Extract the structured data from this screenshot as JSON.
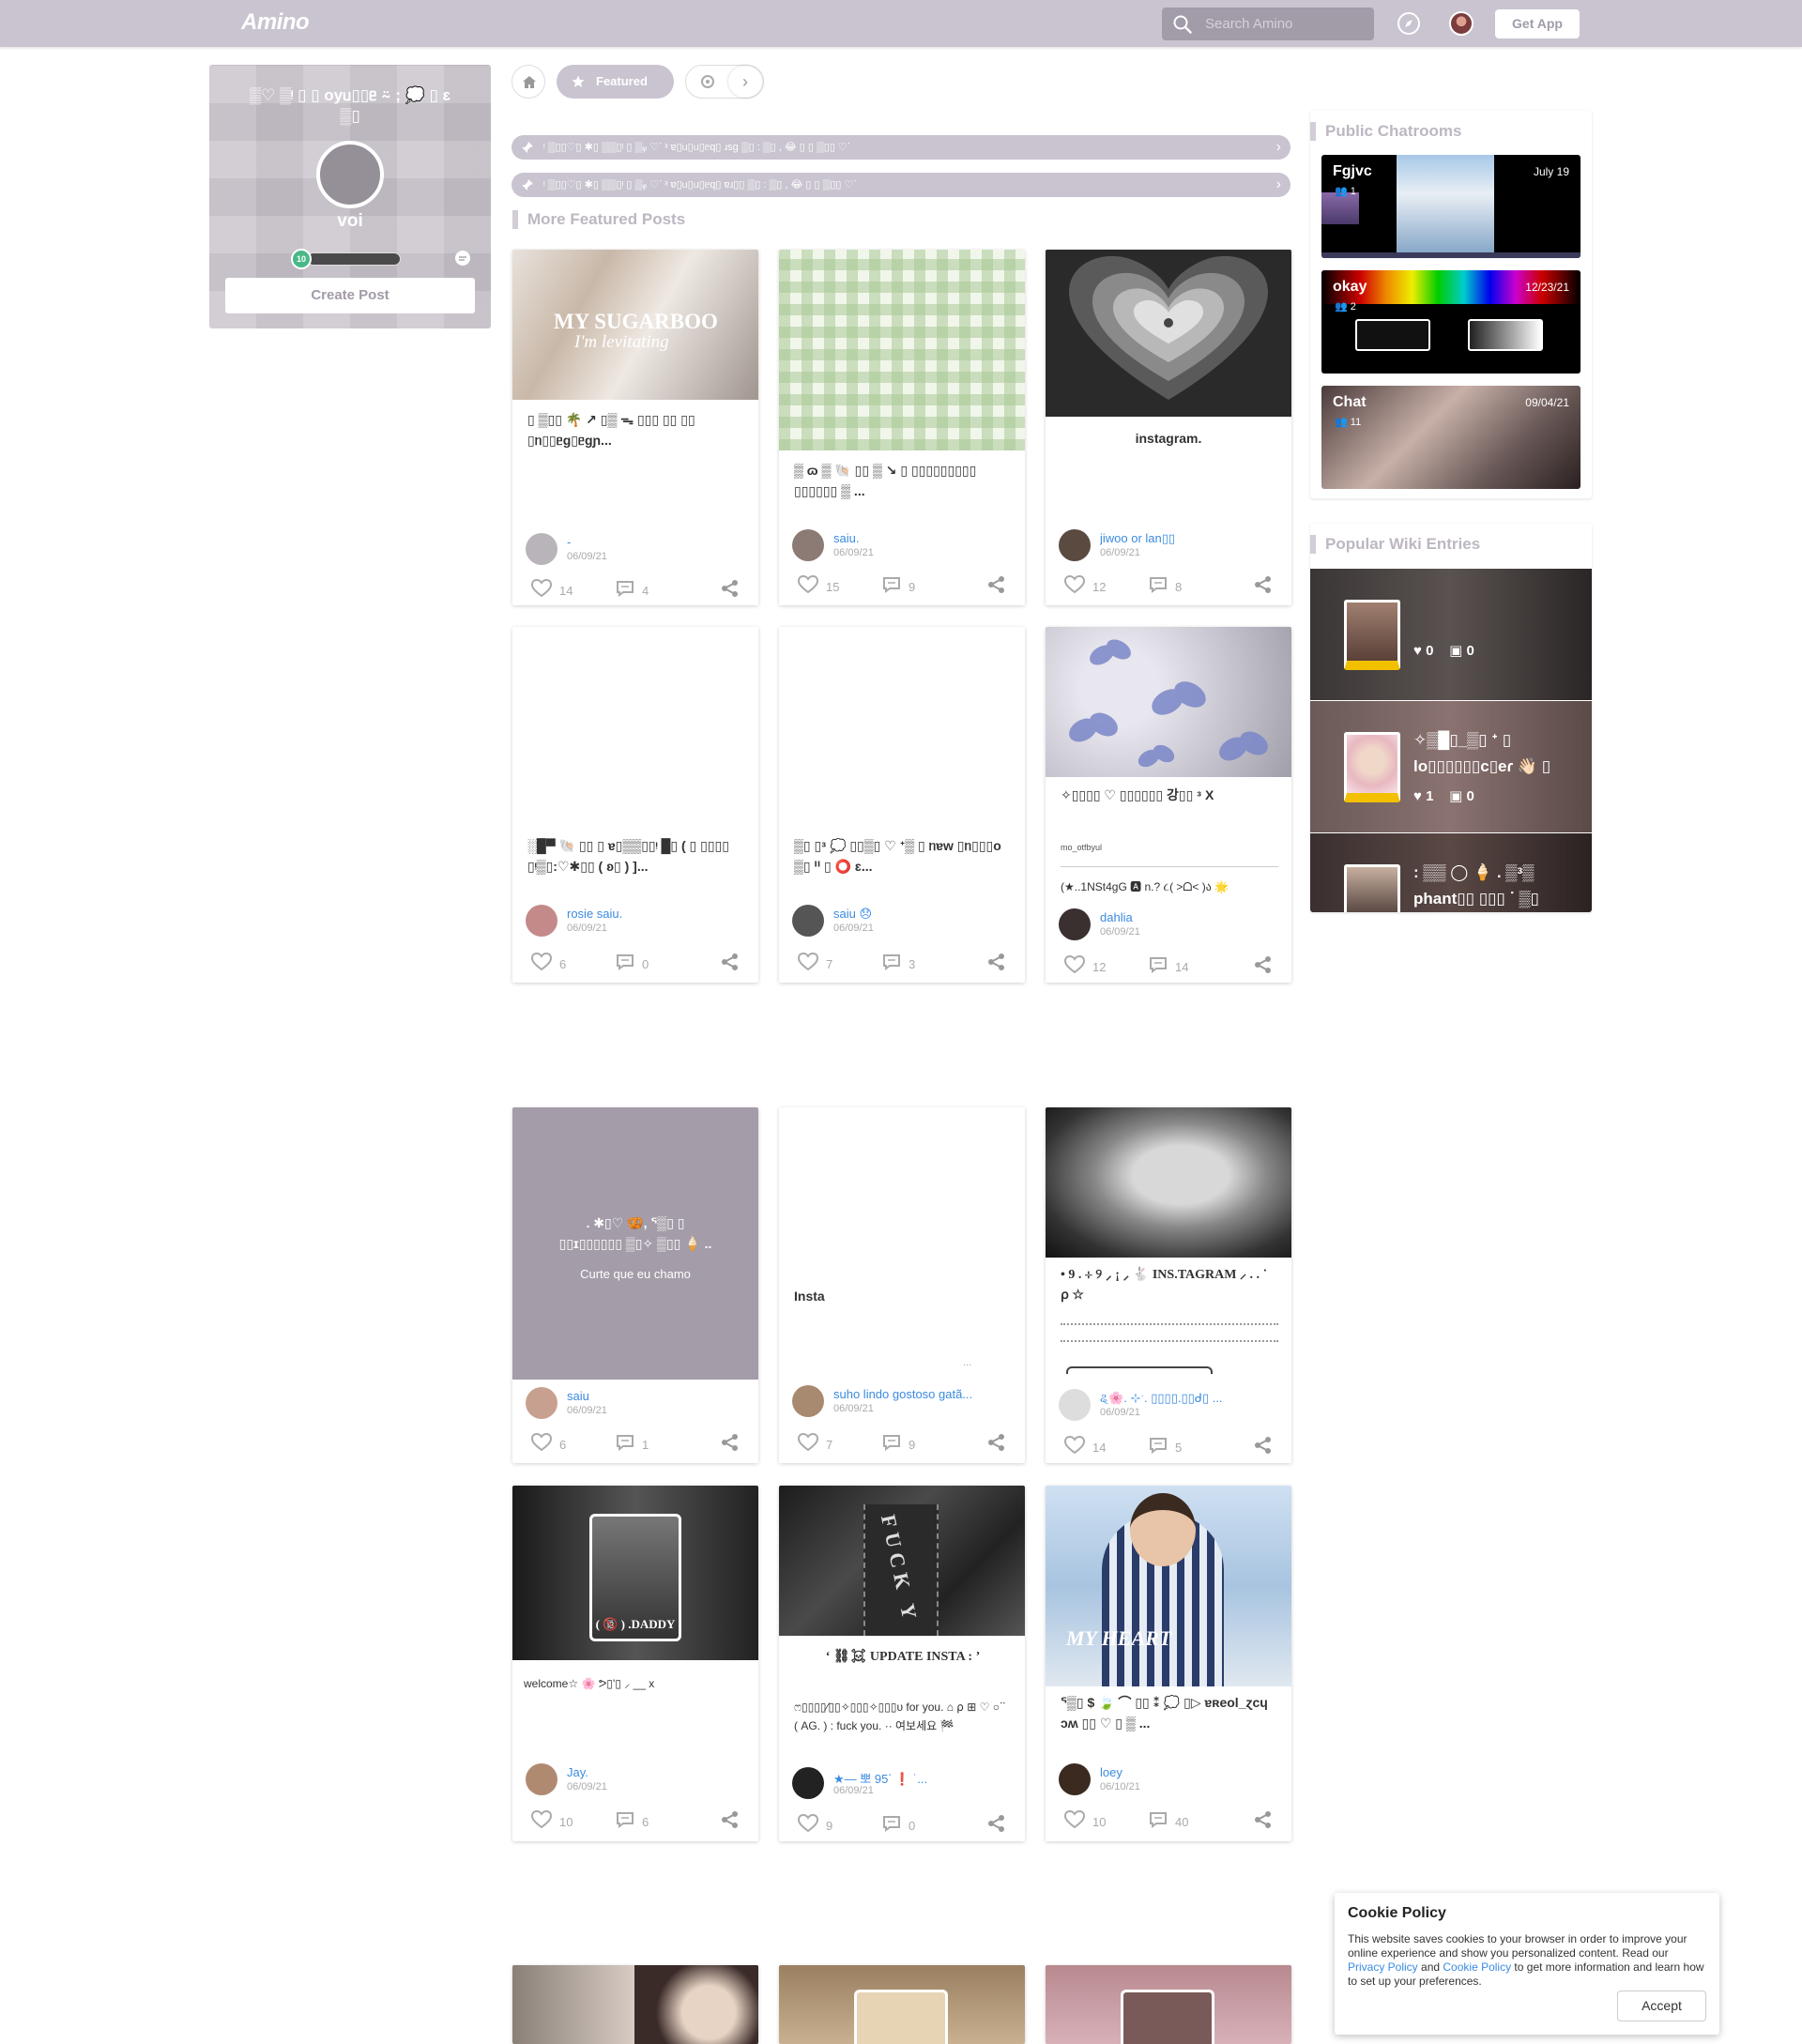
{
  "header": {
    "logo": "Amino",
    "search_placeholder": "Search Amino",
    "get_app": "Get App"
  },
  "profile": {
    "community_title": "▒♡ ▒ᵎ ▯ ▯ oyᥙ▯▯ᥱ ⍨ ; 💭 ▯ ɛ",
    "community_title_2": "▒▯",
    "username": "voi",
    "level": "10",
    "create_post": "Create Post"
  },
  "tabs": {
    "featured": "Featured"
  },
  "pinned": [
    "ᵎ ▒▯▯♡▯ ✱▯ ▒▒▯ᵎ ▯ ▒ᵩ ♡ᐝ ᵌ ɐ▯ᥙ▯ᥙ▯ᥱq▯ ɹsɡ ▒▯ : ▒▯ , 😂 ▯ ▯ ▒▯▯ ♡ᐝ",
    "ᵎ ▒▯▯♡▯ ✱▯ ▒▒▯ᵎ ▯ ▒ᵩ ♡ᐝ ᵌ ɐ▯ᥙ▯ᥙ▯ᥱq▯ ɐɹ▯▯ ▒▯ : ▒▯ , 😂 ▯ ▯ ▒▯▯ ♡ᐝ"
  ],
  "sections": {
    "more_featured": "More Featured Posts",
    "public_chatrooms": "Public Chatrooms",
    "popular_wiki": "Popular Wiki Entries"
  },
  "posts": [
    {
      "overlay": "MY SUGARBOO",
      "overlay2": "I'm levitating",
      "title": "▯ ▒▯▯ 🌴 ↗ ▯▒ ᯓ ▯▯▯ ▯▯ ▯▯ ▯ᥒ▯▯ᥱɡ▯ᥱɡɲ...",
      "author": "-",
      "date": "06/09/21",
      "likes": "14",
      "comments": "4"
    },
    {
      "title": "▒ ɷ ▒ 🐚 ▯▯ ▒ ↘ ▯ ▯▯▯▯▯▯▯▯▯ ▯▯▯▯▯▯ ▒ ...",
      "author": "saiu.",
      "date": "06/09/21",
      "likes": "15",
      "comments": "9"
    },
    {
      "title": "instagram.",
      "author": "jiwoo or lan▯▯",
      "date": "06/09/21",
      "likes": "12",
      "comments": "8"
    },
    {
      "title": "░█▀ 🐚 ▯▯ ▯ ɐ▯▒▒▯▯ᵎ █▯ ( ▯ ▯▯▯▯ ▯ᵎ▒▯:♡✱▯▯ ( ʚ▯ ) ]...",
      "author": "rosie saiu.",
      "date": "06/09/21",
      "likes": "6",
      "comments": "0"
    },
    {
      "title": "▒▯ ▯ᵌ 💭 ▯▯▒▯ ♡ ᐩ▒ ▯ ᥒɐw ▯ᥒ▯▯▯o ▒▯ ᐦ ▯ ⭕ ɛ...",
      "author": "saiu 😞",
      "date": "06/09/21",
      "likes": "7",
      "comments": "3"
    },
    {
      "title": "✧▯▯▯▯ ♡ ▯▯▯▯▯▯ 강▯▯ ᵌ X",
      "subtitle": "mo_otfbyul",
      "extra": "(★..1NSt4gG 🅰 n.? ૮( ˃ᗝ˂ )ა 🌟",
      "author": "dahlia",
      "date": "06/09/21",
      "likes": "12",
      "comments": "14"
    },
    {
      "overlay": ". ✱▯♡ 🥨, ᕐ▒▯ ▯",
      "overlay2": "▯▯ɪ▯▯▯▯▯▯ ▒▯✧ ▒▯▯ 🍦 ..",
      "overlay3": "Curte que eu chamo",
      "author": "saiu",
      "date": "06/09/21",
      "likes": "6",
      "comments": "1"
    },
    {
      "title": "Insta",
      "dots": "...",
      "author": "suho lindo gostoso gatã...",
      "date": "06/09/21",
      "likes": "7",
      "comments": "9"
    },
    {
      "title": "• 9 . ⊹ ୨ ⸝ ¡ ⸝ 🐇 INS.TAGRAM ⸝ . . ˙ ⍴ ☆",
      "author": "ୡ🌸. ⊹ˑ. ▯▯▯▯.▯▯ᑯ▯ ...",
      "date": "06/09/21",
      "likes": "14",
      "comments": "5"
    },
    {
      "overlay": "( 🔞 ) .DADDY",
      "title": "welcome☆ 🌸 ᕗ▯'▯ ⸝ __ x",
      "author": "Jay.",
      "date": "06/09/21",
      "likes": "10",
      "comments": "6"
    },
    {
      "overlay": "FUCK Y",
      "title": "ʻ ⛓☠ UPDATE INSTA : ʼ",
      "body": "ෆ▯▯▯▯⁄▯▯✧▯▯▯✧▯▯▯υ for you. ⌂ ⍴ ⊞ ♡ ○ᐝᐝ ( AG. ) : fuck you. ·· 여보세요 🏁",
      "author": "★— 뽀 95ᐝ ❗ ˙...",
      "date": "06/09/21",
      "likes": "9",
      "comments": "0"
    },
    {
      "overlay": "MY HEART",
      "title": "ᕐ▒▯ $ 🍃 ⌒ ▯▯ ⁑ 💭 ▯▷ ɐʀeol_ɀcɥ ɔʍ ▯▯ ♡ ▯ ▒ ...",
      "author": "loey",
      "date": "06/10/21",
      "likes": "10",
      "comments": "40"
    }
  ],
  "chatrooms": [
    {
      "name": "Fgjvc",
      "date": "July 19",
      "count": "1"
    },
    {
      "name": "okay",
      "date": "12/23/21",
      "count": "2"
    },
    {
      "name": "Chat",
      "date": "09/04/21",
      "count": "11"
    }
  ],
  "wikis": [
    {
      "title": "",
      "likes": "0",
      "comments": "0"
    },
    {
      "title": "✧▒█▯_▒▯ ᐩ ▯",
      "title2": "lo▯▯▯▯▯▯c▯eɾ 👋🏻 ▯",
      "likes": "1",
      "comments": "0"
    },
    {
      "title": ": ▒▒ ◯ 🍦 . ▒ᵌ▒",
      "title2": "phant▯▯ ▯▯▯ ᐝ ▒▯"
    }
  ],
  "cookie": {
    "title": "Cookie Policy",
    "text1": "This website saves cookies to your browser in order to improve your online experience and show you personalized content. Read our ",
    "privacy": "Privacy Policy",
    "and": " and ",
    "cookie_link": "Cookie Policy",
    "text2": " to get more information and learn how to set up your preferences.",
    "accept": "Accept"
  },
  "colors": {
    "nav": "#c9c4cf",
    "accent": "#a29ba8",
    "link": "#3b8be0",
    "badge": "#f3c000"
  }
}
